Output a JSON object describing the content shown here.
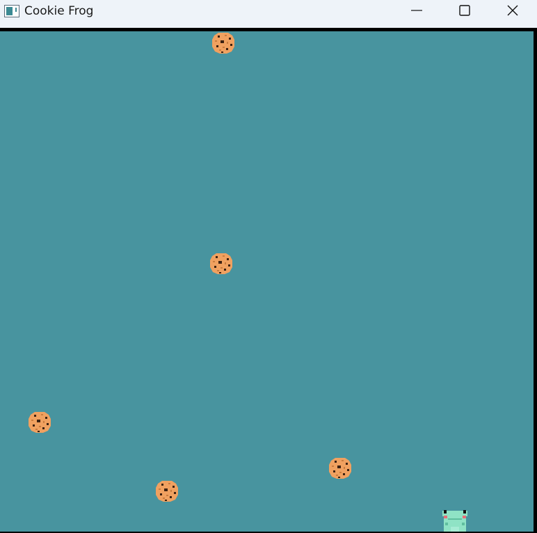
{
  "window": {
    "title": "Cookie Frog",
    "icon": "app-window-icon",
    "controls": {
      "minimize_icon": "minimize-icon",
      "maximize_icon": "maximize-icon",
      "close_icon": "close-icon"
    }
  },
  "game": {
    "background_color": "#48949f",
    "frame_color": "#000000",
    "cookie_count_visible": 5,
    "cookie_colors": {
      "dough": "#f0a160",
      "crumb": "#c97c3e",
      "chip": "#3d2212"
    },
    "player": {
      "name": "frog",
      "colors": {
        "body": "#8fe3c5",
        "shade": "#5fbf9f",
        "eye": "#111111",
        "cheek": "#e6707a"
      }
    }
  }
}
